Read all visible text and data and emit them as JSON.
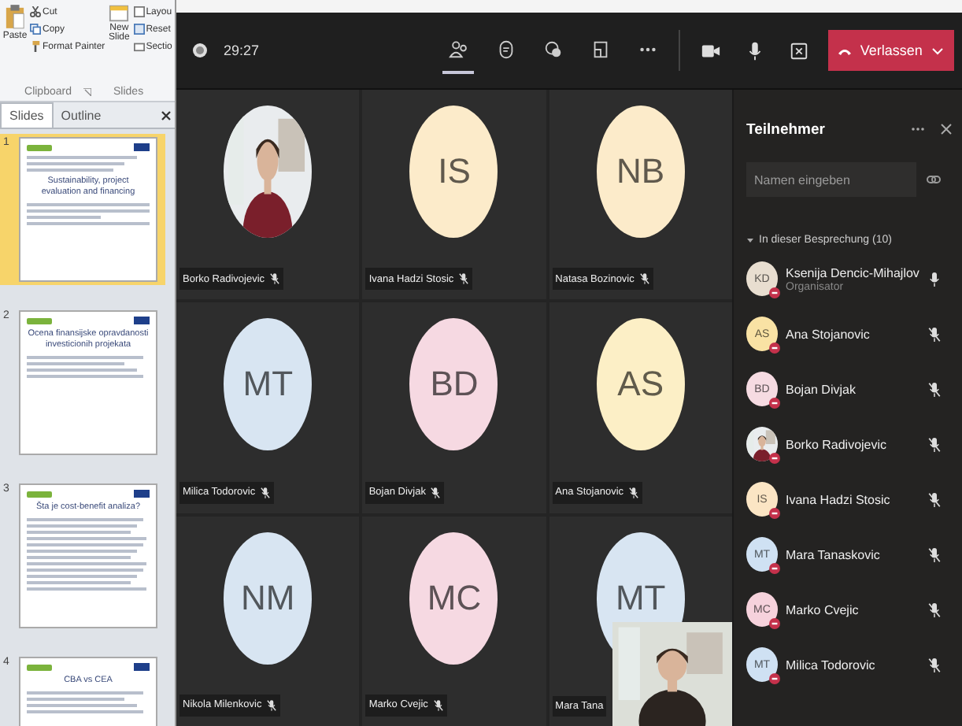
{
  "ribbon": {
    "paste": "Paste",
    "cut": "Cut",
    "copy": "Copy",
    "format_painter": "Format Painter",
    "new_slide_1": "New",
    "new_slide_2": "Slide",
    "layout": "Layou",
    "reset": "Reset",
    "section": "Sectio",
    "groups": [
      "Clipboard",
      "Slides"
    ]
  },
  "pane_tabs": [
    {
      "label": "Slides",
      "selected": true
    },
    {
      "label": "Outline",
      "selected": false
    }
  ],
  "slides": [
    {
      "number": "1",
      "selected": true,
      "kind": "title",
      "title": "Sustainability, project evaluation and financing"
    },
    {
      "number": "2",
      "selected": false,
      "kind": "bullets",
      "title": "Ocena finansijske opravdanosti investicionih projekata"
    },
    {
      "number": "3",
      "selected": false,
      "kind": "dense",
      "title": "Šta je cost-benefit analiza?"
    },
    {
      "number": "4",
      "selected": false,
      "kind": "bullets",
      "title": "CBA vs CEA"
    }
  ],
  "meeting": {
    "recording": true,
    "timer": "29:27",
    "toolbar": [
      {
        "kind": "people",
        "selected": true
      },
      {
        "kind": "chat",
        "selected": false
      },
      {
        "kind": "reactions",
        "selected": false
      },
      {
        "kind": "rooms",
        "selected": false
      },
      {
        "kind": "more",
        "selected": false
      }
    ],
    "controls": [
      {
        "kind": "camera"
      },
      {
        "kind": "mic"
      },
      {
        "kind": "share"
      }
    ],
    "leave": "Verlassen"
  },
  "tile_avatars": [
    {
      "kind": "picture"
    },
    {
      "kind": "initials",
      "initials": "IS",
      "color": "#fcebca"
    },
    {
      "kind": "initials",
      "initials": "NB",
      "color": "#fcebca"
    },
    {
      "kind": "initials",
      "initials": "MT",
      "color": "#d8e5f2"
    },
    {
      "kind": "initials",
      "initials": "BD",
      "color": "#f6d9e2"
    },
    {
      "kind": "initials",
      "initials": "AS",
      "color": "#fcefc6"
    },
    {
      "kind": "initials",
      "initials": "NM",
      "color": "#d8e5f2"
    },
    {
      "kind": "initials",
      "initials": "MC",
      "color": "#f6d9e2"
    },
    {
      "kind": "initials",
      "initials": "MT",
      "color": "#d8e5f2"
    }
  ],
  "tile_labels": [
    {
      "name": "Borko Radivojevic",
      "muted": true
    },
    {
      "name": "Ivana Hadzi Stosic",
      "muted": true
    },
    {
      "name": "Natasa Bozinovic",
      "muted": true
    },
    {
      "name": "Milica Todorovic",
      "muted": true
    },
    {
      "name": "Bojan Divjak",
      "muted": true
    },
    {
      "name": "Ana Stojanovic",
      "muted": true
    },
    {
      "name": "Nikola Milenkovic",
      "muted": true
    },
    {
      "name": "Marko Cvejic",
      "muted": true
    },
    {
      "name": "Mara Tana"
    }
  ],
  "self_view": {
    "kind": "picture"
  },
  "panel": {
    "title": "Teilnehmer",
    "search": {
      "placeholder": "Namen eingeben"
    },
    "section": {
      "label": "In dieser Besprechung (10)",
      "expanded": true
    },
    "participants": [
      {
        "name": "Ksenija Dencic-Mihajlov",
        "role": "Organisator",
        "kind": "initials",
        "initials": "KD",
        "color": "#e8ded0",
        "muted": false
      },
      {
        "name": "Ana Stojanovic",
        "kind": "initials",
        "initials": "AS",
        "color": "#f9e2a4",
        "muted": true
      },
      {
        "name": "Bojan Divjak",
        "kind": "initials",
        "initials": "BD",
        "color": "#f6dbe2",
        "muted": true
      },
      {
        "name": "Borko Radivojevic",
        "kind": "picture",
        "muted": true
      },
      {
        "name": "Ivana Hadzi Stosic",
        "kind": "initials",
        "initials": "IS",
        "color": "#fbe5c4",
        "muted": true
      },
      {
        "name": "Mara Tanaskovic",
        "kind": "initials",
        "initials": "MT",
        "color": "#cfe1f3",
        "muted": true
      },
      {
        "name": "Marko Cvejic",
        "kind": "initials",
        "initials": "MC",
        "color": "#f6d2dc",
        "muted": true
      },
      {
        "name": "Milica Todorovic",
        "kind": "initials",
        "initials": "MT",
        "color": "#cfe1f3",
        "muted": true
      }
    ]
  }
}
